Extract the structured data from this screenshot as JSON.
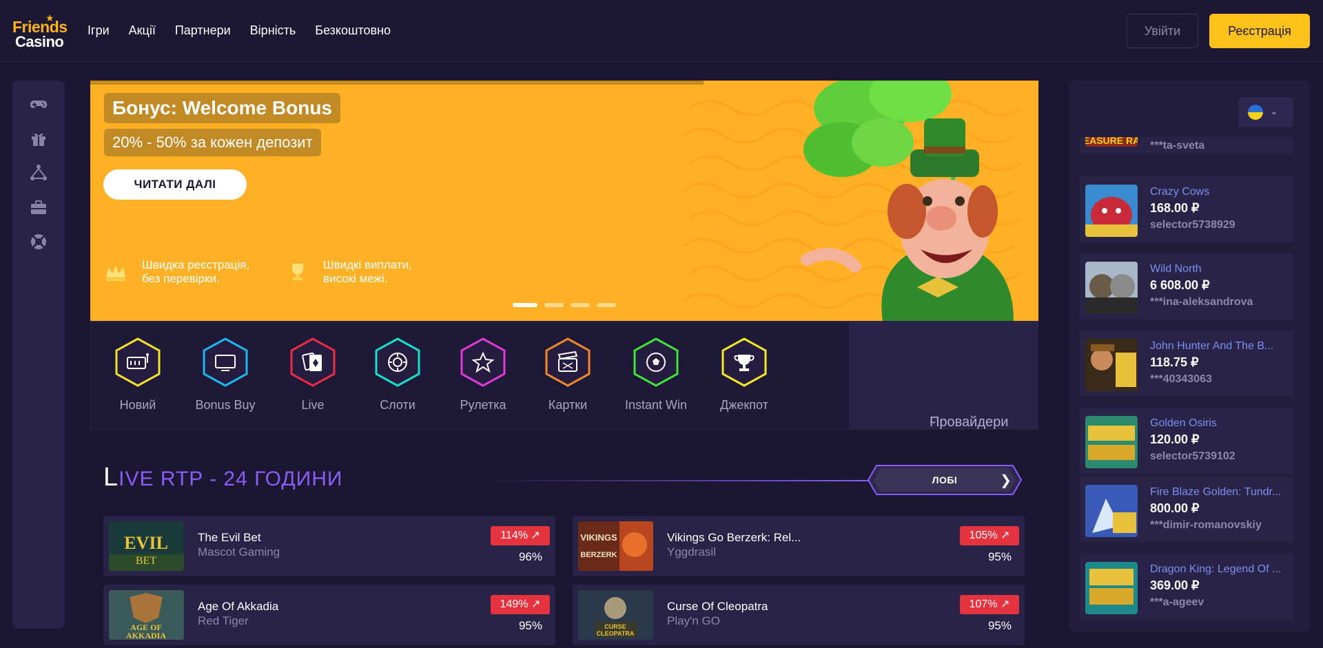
{
  "header": {
    "logo_top": "Friends",
    "logo_bottom": "Casino",
    "nav": [
      "Ігри",
      "Акції",
      "Партнери",
      "Вірність",
      "Безкоштовно"
    ],
    "login_label": "Увійти",
    "register_label": "Реєстрація"
  },
  "sidebar": {
    "icons": [
      "gamepad-icon",
      "gift-icon",
      "network-icon",
      "briefcase-icon",
      "lifebuoy-icon"
    ]
  },
  "banner": {
    "title": "Бонус: Welcome Bonus",
    "subtitle": "20% - 50% за кожен депозит",
    "cta": "ЧИТАТИ ДАЛІ",
    "feature1": "Швидка реєстрація,\nбез перевірки.",
    "feature2": "Швидкі виплати,\nвисокі межі.",
    "slides": 4,
    "active_slide": 1
  },
  "categories": [
    {
      "label": "Новий",
      "icon": "slot-machine-icon",
      "color": "#f5e12a"
    },
    {
      "label": "Bonus Buy",
      "icon": "monitor-icon",
      "color": "#1fb6f2"
    },
    {
      "label": "Live",
      "icon": "cards-icon",
      "color": "#ee2b44"
    },
    {
      "label": "Слоти",
      "icon": "chip-icon",
      "color": "#19e0c9"
    },
    {
      "label": "Рулетка",
      "icon": "star-icon",
      "color": "#e23ad6"
    },
    {
      "label": "Картки",
      "icon": "clapper-icon",
      "color": "#f2882a"
    },
    {
      "label": "Instant Win",
      "icon": "soccer-ball-icon",
      "color": "#3fe53a"
    },
    {
      "label": "Джекпот",
      "icon": "trophy-icon",
      "color": "#f5e92a"
    }
  ],
  "providers_label": "Провайдери",
  "live_rtp": {
    "title_first": "L",
    "title_rest": "IVE RTP - 24 ГОДИНИ",
    "lobby_label": "ЛОБІ",
    "rows": [
      {
        "name": "The Evil Bet",
        "provider": "Mascot Gaming",
        "badge": "114%",
        "rtp": "96%"
      },
      {
        "name": "Vikings Go Berzerk: Rel...",
        "provider": "Yggdrasil",
        "badge": "105%",
        "rtp": "95%"
      },
      {
        "name": "Age Of Akkadia",
        "provider": "Red Tiger",
        "badge": "149%",
        "rtp": "95%"
      },
      {
        "name": "Curse Of Cleopatra",
        "provider": "Play'n GO",
        "badge": "107%",
        "rtp": "95%"
      }
    ]
  },
  "feed": {
    "partial_user": "***ta-sveta",
    "partial_thumb_text": "EASURE RA",
    "wins": [
      {
        "game": "Crazy Cows",
        "amount": "168.00 ₽",
        "user": "selector5738929",
        "thumb": "#c82a3a"
      },
      {
        "game": "Wild North",
        "amount": "6 608.00 ₽",
        "user": "***ina-aleksandrova",
        "thumb": "#6b5a48"
      },
      {
        "game": "John Hunter And The B...",
        "amount": "118.75 ₽",
        "user": "***40343063",
        "thumb": "#8a5a22"
      },
      {
        "game": "Golden Osiris",
        "amount": "120.00 ₽",
        "user": "selector5739102",
        "thumb": "#2c8a6e"
      },
      {
        "game": "Fire Blaze Golden: Tundr...",
        "amount": "800.00 ₽",
        "user": "***dimir-romanovskiy",
        "thumb": "#3a5ab8"
      },
      {
        "game": "Dragon King: Legend Of ...",
        "amount": "369.00 ₽",
        "user": "***a-ageev",
        "thumb": "#1e8a8a"
      }
    ]
  }
}
